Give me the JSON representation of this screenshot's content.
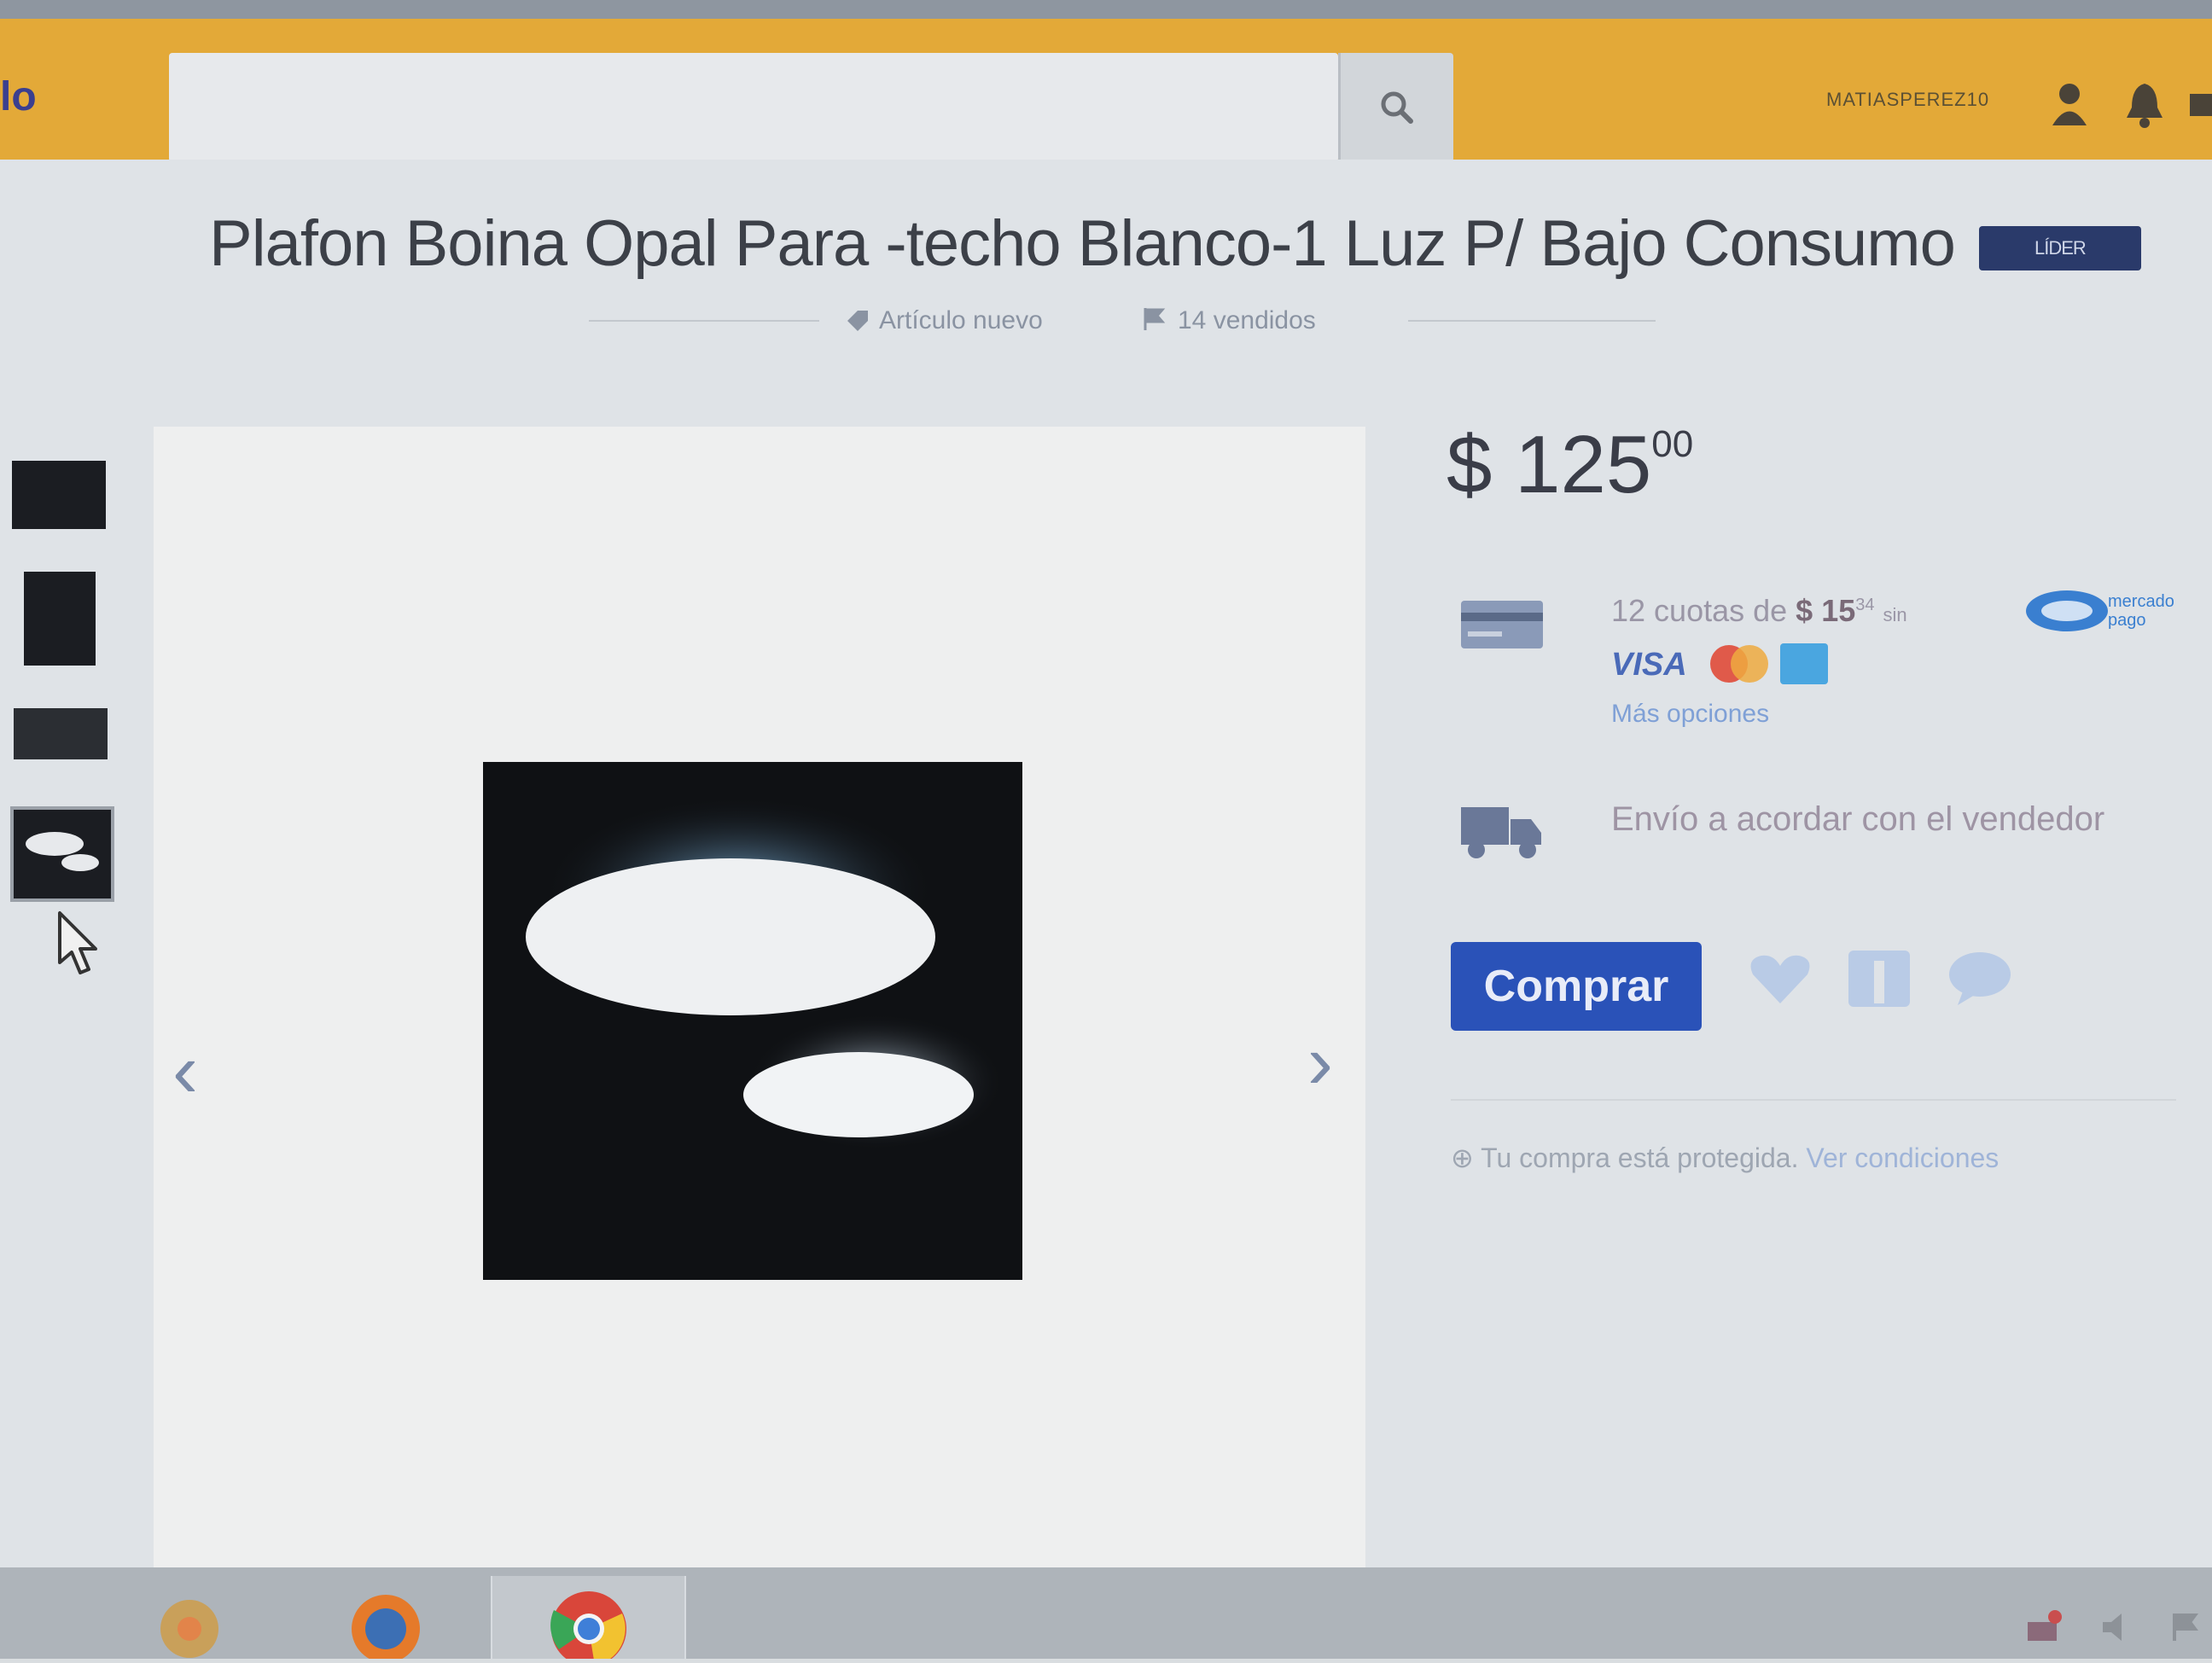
{
  "header": {
    "logo_fragment": "lo",
    "search_placeholder": "",
    "user_name": "MATIASPEREZ10"
  },
  "product": {
    "title": "Plafon Boina Opal Para -techo Blanco-1 Luz P/ Bajo Consumo",
    "badge": "LÍDER",
    "condition": "Artículo nuevo",
    "sold": "14 vendidos"
  },
  "price": {
    "symbol": "$",
    "integer": "125",
    "cents": "00"
  },
  "payment": {
    "installments_prefix": "12 cuotas de",
    "installment_amount": "$ 15",
    "installment_cents": "34",
    "installments_suffix": "sin",
    "mp_logo_text": "mercado pago",
    "visa_label": "VISA",
    "more_options": "Más opciones"
  },
  "shipping": {
    "text": "Envío a acordar con el vendedor"
  },
  "actions": {
    "buy_label": "Comprar"
  },
  "protection": {
    "text": "Tu compra está protegida.",
    "link": "Ver condiciones"
  },
  "colors": {
    "header_yellow": "#e3a938",
    "buy_blue": "#2a52b8"
  }
}
